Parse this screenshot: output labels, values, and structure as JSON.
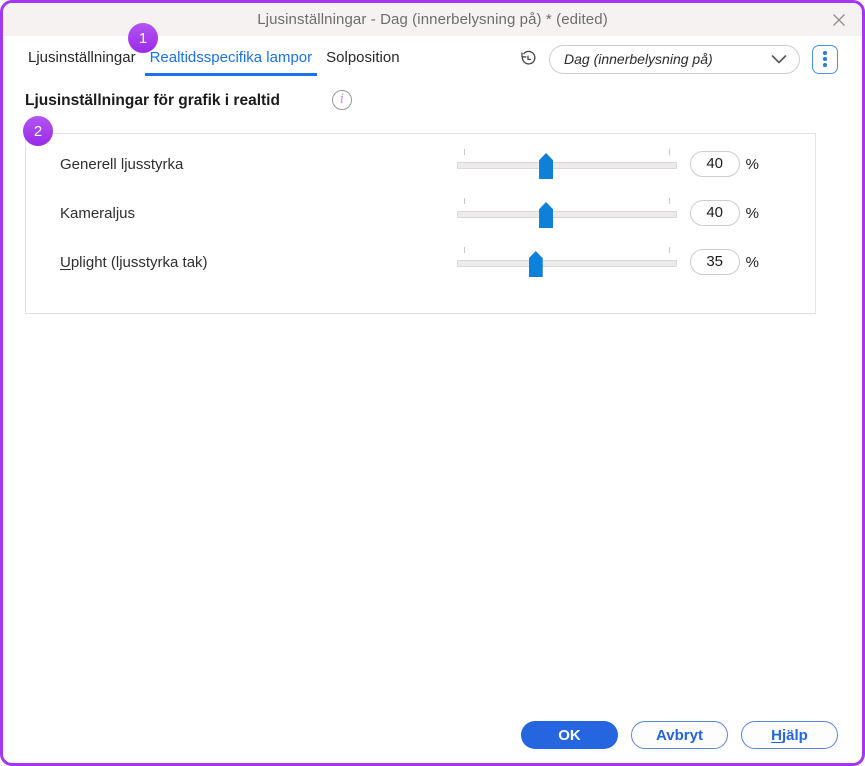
{
  "window": {
    "title": "Ljusinställningar - Dag (innerbelysning på) * (edited)"
  },
  "tabs": [
    {
      "label": "Ljusinställningar"
    },
    {
      "label": "Realtidsspecifika lampor"
    },
    {
      "label": "Solposition"
    }
  ],
  "toolbar": {
    "preset_value": "Dag (innerbelysning på)"
  },
  "annotations": {
    "step1": "1",
    "step2": "2"
  },
  "section": {
    "heading": "Ljusinställningar för grafik i realtid",
    "info_glyph": "i"
  },
  "sliders": [
    {
      "label": "Generell ljusstyrka",
      "value": 40,
      "unit": "%"
    },
    {
      "label": "Kameraljus",
      "value": 40,
      "unit": "%"
    },
    {
      "label": "Uplight (ljusstyrka tak)",
      "value": 35,
      "unit": "%",
      "accesskey": "U"
    }
  ],
  "footer": {
    "ok": "OK",
    "cancel": "Avbryt",
    "help": "Hjälp",
    "help_accesskey": "H"
  },
  "colors": {
    "annotation_purple": "#a435f0",
    "tab_active_blue": "#1a73e8",
    "slider_thumb_blue": "#0e80d8",
    "button_blue": "#2565e0",
    "titlebar_bg": "#f7f2f2"
  }
}
